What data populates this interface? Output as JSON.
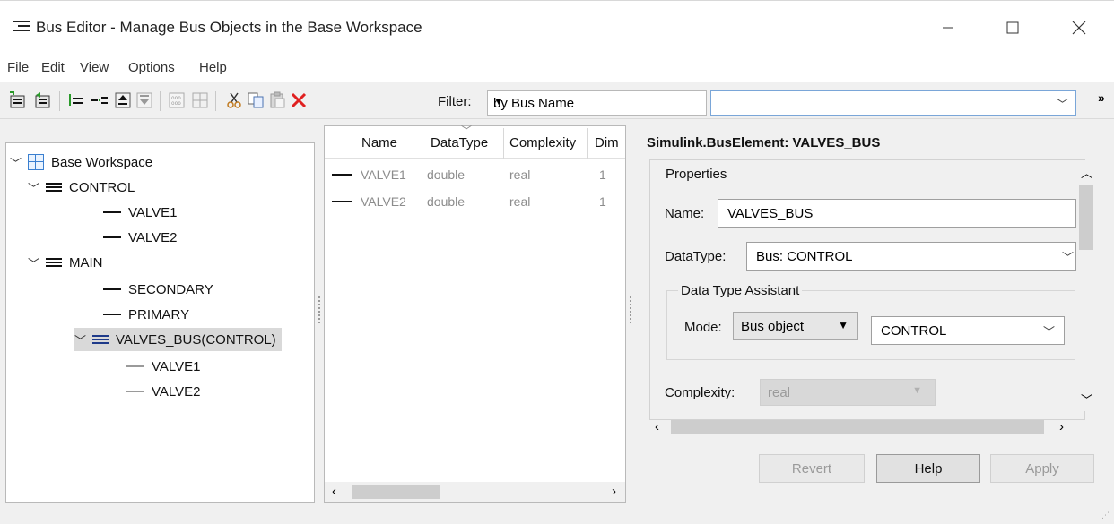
{
  "window": {
    "title": "Bus Editor - Manage Bus Objects in the Base Workspace",
    "app_icon": "bus-editor-icon",
    "controls": [
      "minimize",
      "maximize",
      "close"
    ]
  },
  "menu": [
    "File",
    "Edit",
    "View",
    "Options",
    "Help"
  ],
  "toolbar": {
    "buttons": [
      "add-bus-icon",
      "insert-bus-icon",
      "add-element-icon",
      "insert-element-icon",
      "move-up-icon",
      "move-down-icon",
      "expand-icon",
      "layout-icon",
      "cut-icon",
      "copy-icon",
      "paste-icon",
      "delete-icon"
    ],
    "filter_label": "Filter:",
    "filter_mode": "by Bus Name",
    "filter_text": "",
    "more": "»"
  },
  "tree": {
    "root": "Base Workspace",
    "items": [
      {
        "label": "CONTROL",
        "type": "bus"
      },
      {
        "label": "VALVE1",
        "type": "element"
      },
      {
        "label": "VALVE2",
        "type": "element"
      },
      {
        "label": "MAIN",
        "type": "bus"
      },
      {
        "label": "SECONDARY",
        "type": "element"
      },
      {
        "label": "PRIMARY",
        "type": "element"
      },
      {
        "label": "VALVES_BUS(CONTROL)",
        "type": "bus",
        "selected": true
      },
      {
        "label": "VALVE1",
        "type": "element"
      },
      {
        "label": "VALVE2",
        "type": "element"
      }
    ]
  },
  "elements": {
    "headers": [
      "Name",
      "DataType",
      "Complexity",
      "Dim"
    ],
    "rows": [
      {
        "name": "VALVE1",
        "datatype": "double",
        "complexity": "real",
        "dim": "1"
      },
      {
        "name": "VALVE2",
        "datatype": "double",
        "complexity": "real",
        "dim": "1"
      }
    ]
  },
  "properties": {
    "title": "Simulink.BusElement: VALVES_BUS",
    "group_label": "Properties",
    "name_label": "Name:",
    "name_value": "VALVES_BUS",
    "datatype_label": "DataType:",
    "datatype_value": "Bus: CONTROL",
    "assistant_label": "Data Type Assistant",
    "mode_label": "Mode:",
    "mode_value": "Bus object",
    "bus_value": "CONTROL",
    "complexity_label": "Complexity:",
    "complexity_value": "real"
  },
  "buttons": {
    "revert": "Revert",
    "help": "Help",
    "apply": "Apply"
  }
}
